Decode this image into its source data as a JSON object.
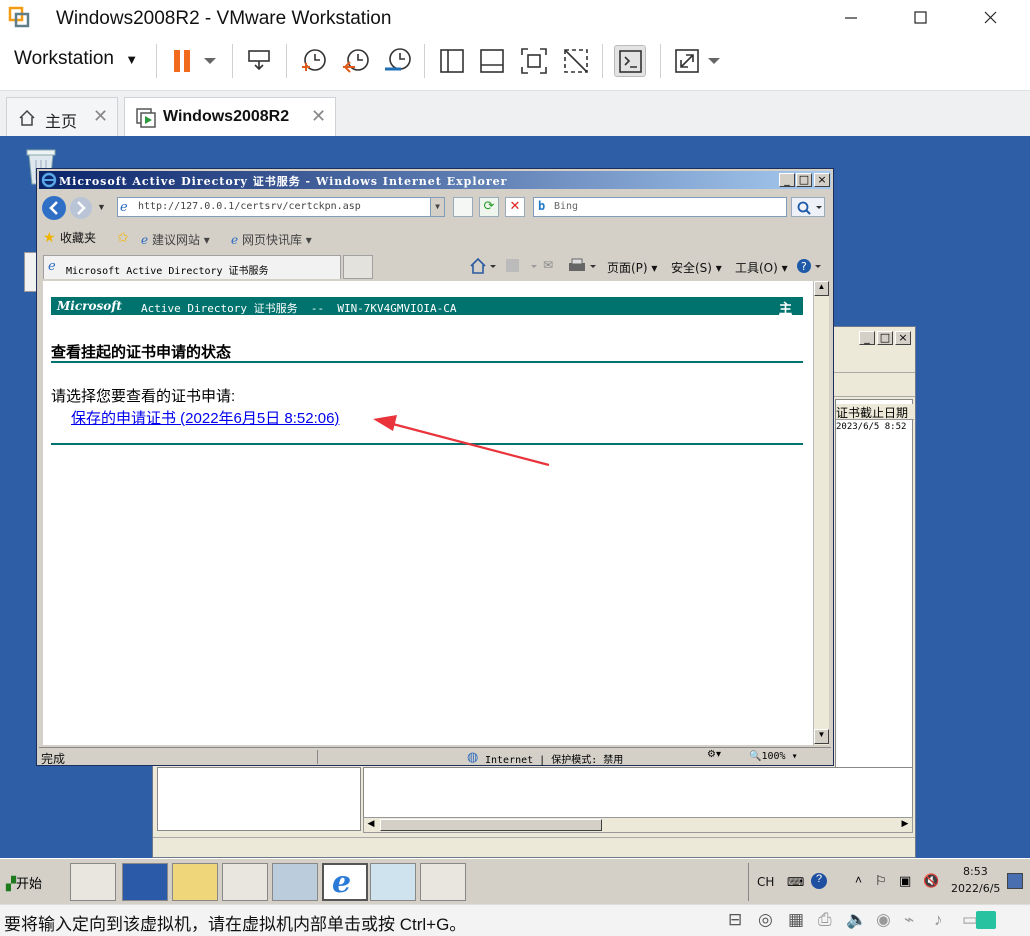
{
  "vmware": {
    "window_title": "Windows2008R2 - VMware Workstation",
    "menu_label": "Workstation",
    "tabs": [
      {
        "label": "主页"
      },
      {
        "label": "Windows2008R2"
      }
    ],
    "status_message": "要将输入定向到该虚拟机，请在虚拟机内部单击或按 Ctrl+G。"
  },
  "ie": {
    "title": "Microsoft Active Directory 证书服务 - Windows Internet Explorer",
    "address": "http://127.0.0.1/certsrv/certckpn.asp",
    "search_placeholder": "Bing",
    "favorites_label": "收藏夹",
    "fav_items": [
      "建议网站 ▾",
      "网页快讯库 ▾"
    ],
    "tab_label": "Microsoft Active Directory 证书服务",
    "cmd_page": "页面(P) ▾",
    "cmd_safety": "安全(S) ▾",
    "cmd_tools": "工具(O) ▾",
    "status_done": "完成",
    "zone": "Internet | 保护模式: 禁用",
    "zoom": "100%"
  },
  "page": {
    "banner_brand": "Microsoft",
    "banner_text": "Active Directory 证书服务  --  WIN-7KV4GMVIOIA-CA",
    "home_link": "主页",
    "heading": "查看挂起的证书申请的状态",
    "prompt": "请选择您要查看的证书申请:",
    "request_link": "保存的申请证书 (2022年6月5日 8:52:06)"
  },
  "bgwin": {
    "col_header": "证书截止日期",
    "cell": "2023/6/5 8:52"
  },
  "taskbar": {
    "start": "开始",
    "lang": "CH",
    "time": "8:53",
    "date": "2022/6/5"
  },
  "colors": {
    "banner": "#00736e",
    "link": "#0000ee",
    "arrow": "#e8343a",
    "desktop": "#2e5ea6"
  }
}
